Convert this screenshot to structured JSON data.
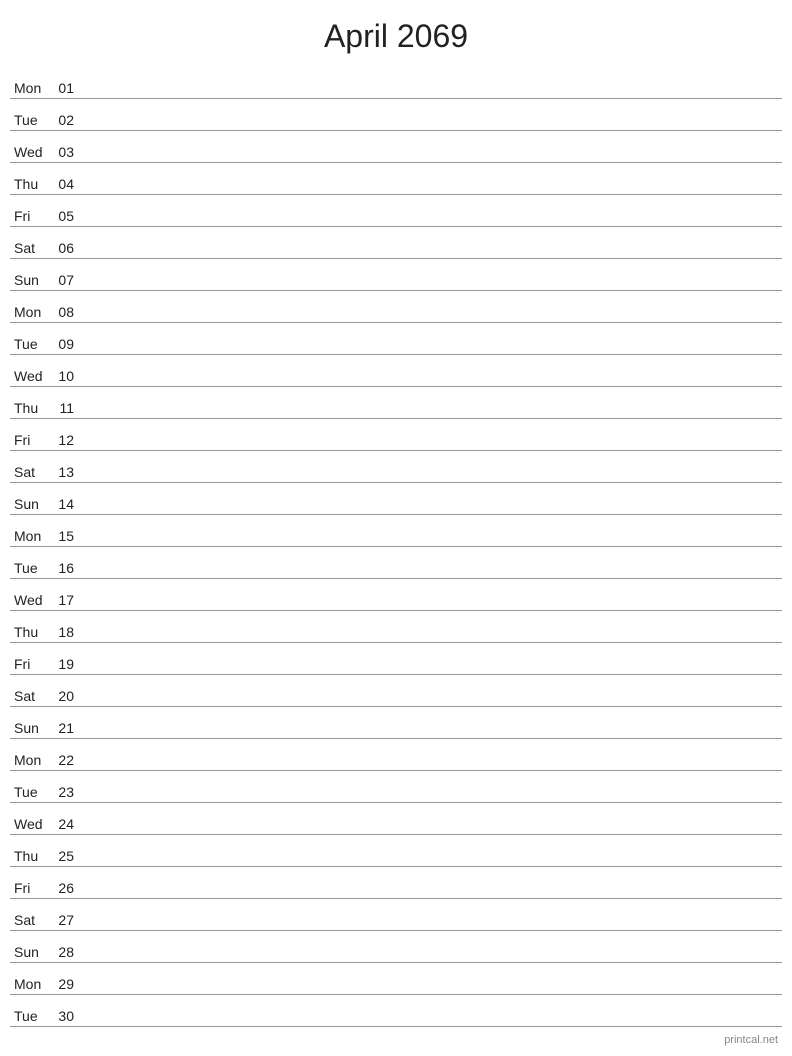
{
  "title": "April 2069",
  "watermark": "printcal.net",
  "days": [
    {
      "name": "Mon",
      "number": "01"
    },
    {
      "name": "Tue",
      "number": "02"
    },
    {
      "name": "Wed",
      "number": "03"
    },
    {
      "name": "Thu",
      "number": "04"
    },
    {
      "name": "Fri",
      "number": "05"
    },
    {
      "name": "Sat",
      "number": "06"
    },
    {
      "name": "Sun",
      "number": "07"
    },
    {
      "name": "Mon",
      "number": "08"
    },
    {
      "name": "Tue",
      "number": "09"
    },
    {
      "name": "Wed",
      "number": "10"
    },
    {
      "name": "Thu",
      "number": "11"
    },
    {
      "name": "Fri",
      "number": "12"
    },
    {
      "name": "Sat",
      "number": "13"
    },
    {
      "name": "Sun",
      "number": "14"
    },
    {
      "name": "Mon",
      "number": "15"
    },
    {
      "name": "Tue",
      "number": "16"
    },
    {
      "name": "Wed",
      "number": "17"
    },
    {
      "name": "Thu",
      "number": "18"
    },
    {
      "name": "Fri",
      "number": "19"
    },
    {
      "name": "Sat",
      "number": "20"
    },
    {
      "name": "Sun",
      "number": "21"
    },
    {
      "name": "Mon",
      "number": "22"
    },
    {
      "name": "Tue",
      "number": "23"
    },
    {
      "name": "Wed",
      "number": "24"
    },
    {
      "name": "Thu",
      "number": "25"
    },
    {
      "name": "Fri",
      "number": "26"
    },
    {
      "name": "Sat",
      "number": "27"
    },
    {
      "name": "Sun",
      "number": "28"
    },
    {
      "name": "Mon",
      "number": "29"
    },
    {
      "name": "Tue",
      "number": "30"
    }
  ]
}
